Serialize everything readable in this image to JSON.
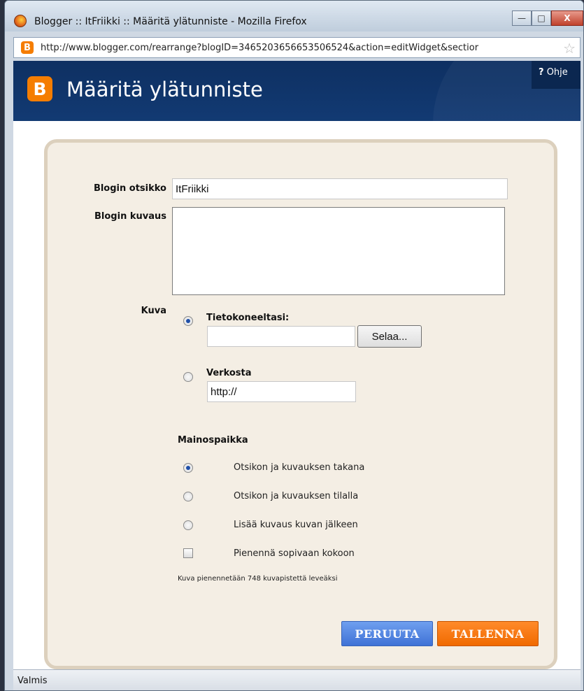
{
  "window": {
    "title": "Blogger :: ItFriikki :: Määritä ylätunniste - Mozilla Firefox",
    "url": "http://www.blogger.com/rearrange?blogID=3465203656653506524&action=editWidget&sectior",
    "buttons": {
      "minimize": "—",
      "maximize": "□",
      "close": "X"
    }
  },
  "header": {
    "logo_letter": "B",
    "title": "Määritä ylätunniste",
    "help_mark": "?",
    "help_label": "Ohje"
  },
  "form": {
    "title_label": "Blogin otsikko",
    "title_value": "ItFriikki",
    "description_label": "Blogin kuvaus",
    "description_value": "",
    "image_label": "Kuva",
    "from_computer_label": "Tietokoneeltasi:",
    "file_value": "",
    "browse_button": "Selaa...",
    "from_web_label": "Verkosta",
    "url_value": "http://",
    "placement_heading": "Mainospaikka",
    "placement_options": [
      {
        "label": "Otsikon ja kuvauksen takana",
        "selected": true
      },
      {
        "label": "Otsikon ja kuvauksen tilalla",
        "selected": false
      },
      {
        "label": "Lisää kuvaus kuvan jälkeen",
        "selected": false
      }
    ],
    "shrink_label": "Pienennä sopivaan kokoon",
    "shrink_checked": false,
    "note": "Kuva pienennetään 748 kuvapistettä leveäksi",
    "cancel_button": "PERUUTA",
    "save_button": "TALLENNA"
  },
  "status": {
    "text": "Valmis"
  },
  "colors": {
    "header_bg": "#123a73",
    "brand_orange": "#f57d00",
    "cancel_blue": "#4f82e0",
    "panel_bg": "#f4eee4"
  },
  "icons": [
    "firefox-icon",
    "blogger-favicon-icon",
    "bookmark-star-icon",
    "blogger-logo-icon"
  ]
}
